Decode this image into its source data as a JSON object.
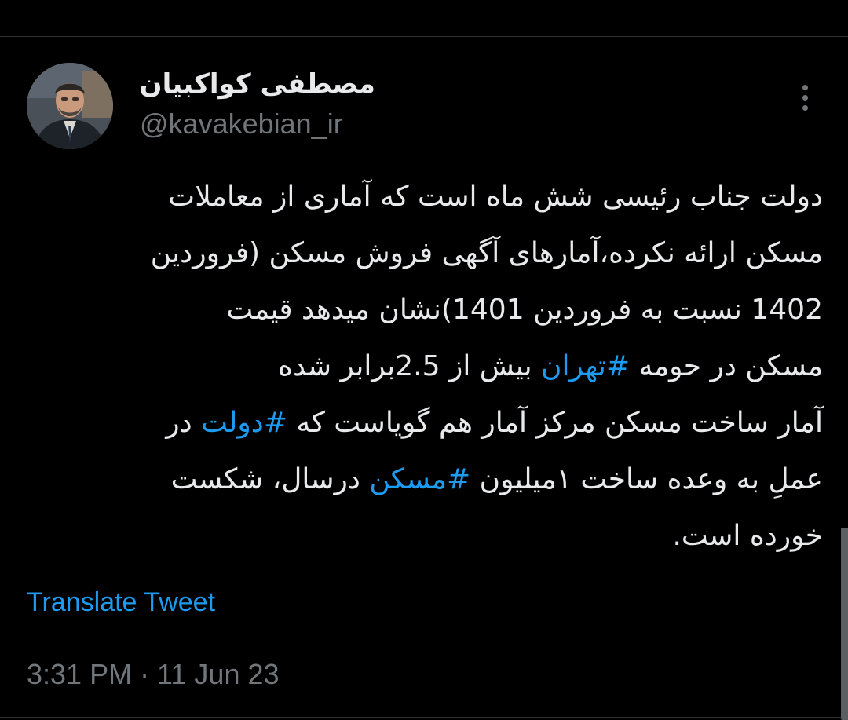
{
  "author": {
    "display_name": "مصطفی کواکبیان",
    "handle": "@kavakebian_ir"
  },
  "more_icon": "more-vertical-icon",
  "tweet": {
    "lines": [
      [
        "دولت جناب رئیسی شش ماه است که آماری از معاملات"
      ],
      [
        "مسکن ارائه نکرده،آمارهای آگهی فروش مسکن (فروردین"
      ],
      [
        "1402 نسبت به فروردین 1401)نشان میدهد قیمت"
      ],
      [
        "مسکن در حومه ",
        "#تهران",
        " بیش از 2.5برابر شده"
      ],
      [
        "آمار ساخت مسکن مرکز آمار هم گویاست که ",
        "#دولت",
        " در"
      ],
      [
        "عملِ به وعده ساخت ۱میلیون ",
        "#مسکن",
        " درسال، شکست"
      ],
      [
        "خورده است."
      ]
    ]
  },
  "translate_label": "Translate Tweet",
  "timestamp": "3:31 PM · 11 Jun 23",
  "colors": {
    "background": "#000000",
    "text": "#e7e9ea",
    "secondary": "#71767b",
    "link": "#1d9bf0",
    "divider": "#2f3336"
  }
}
